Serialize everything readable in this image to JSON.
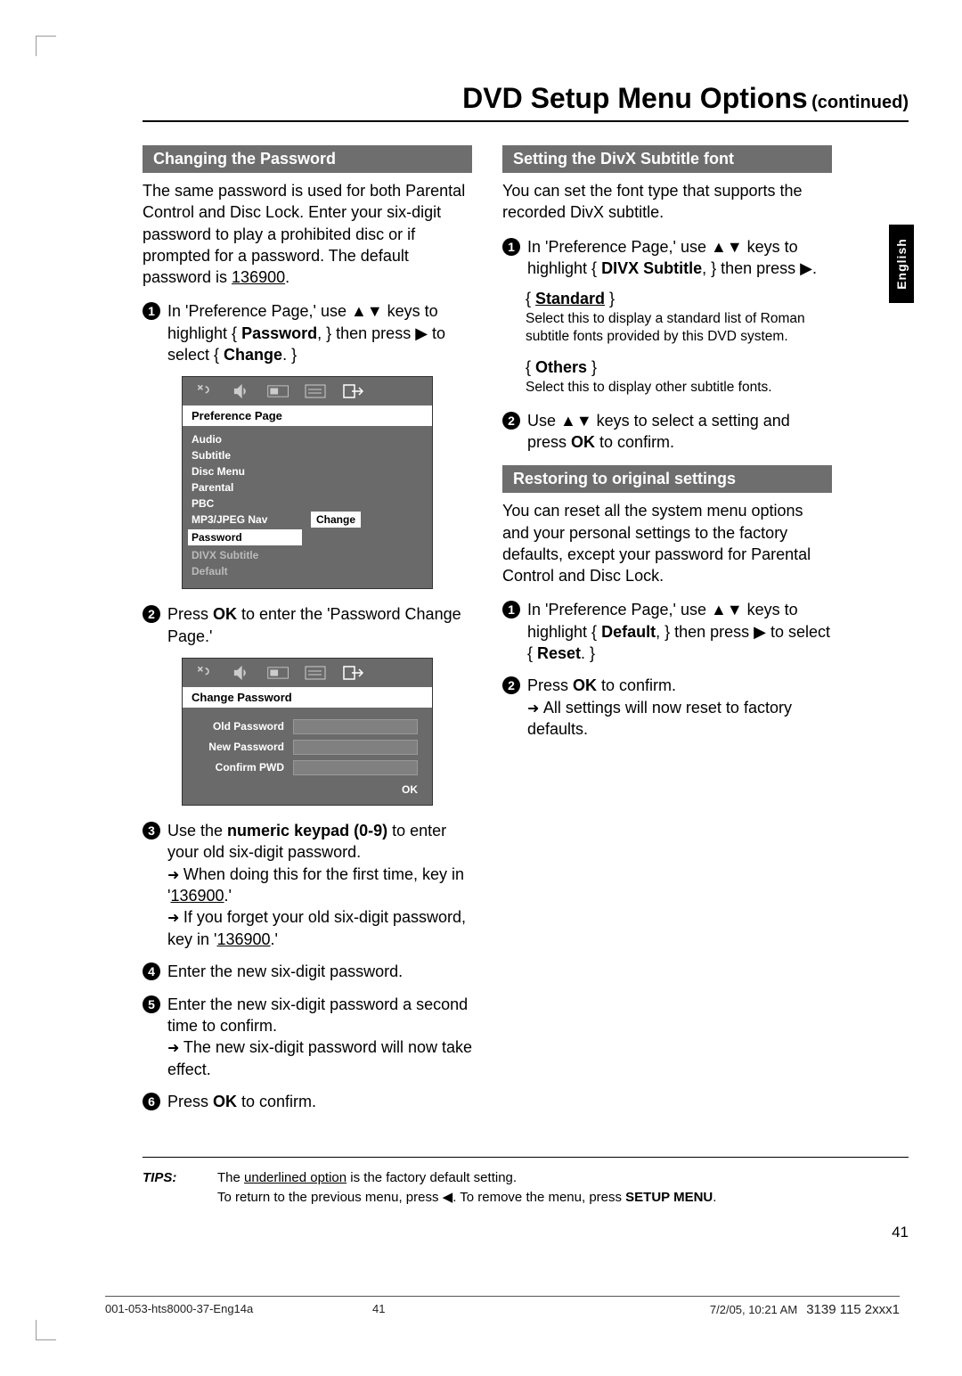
{
  "title": {
    "main": "DVD Setup Menu Options",
    "sub": "(continued)"
  },
  "lang_tab": "English",
  "left": {
    "header": "Changing the Password",
    "intro": "The same password is used for both Parental Control and Disc Lock.  Enter your six-digit password to play a prohibited disc or if prompted for a password.  The default password is ",
    "default_pwd": "136900",
    "step1_a": "In 'Preference Page,' use ",
    "step1_b": " keys to highlight { ",
    "step1_pwd": "Password",
    "step1_c": ", } then press ",
    "step1_d": " to select { ",
    "step1_change": "Change",
    "step1_e": ". }",
    "osd1": {
      "title": "Preference Page",
      "items": [
        "Audio",
        "Subtitle",
        "Disc Menu",
        "Parental",
        "PBC",
        "MP3/JPEG Nav",
        "Password",
        "DIVX Subtitle",
        "Default"
      ],
      "selected": "Password",
      "action": "Change"
    },
    "step2_a": "Press ",
    "step2_ok": "OK",
    "step2_b": " to enter the 'Password Change Page.'",
    "osd2": {
      "title": "Change Password",
      "rows": [
        "Old Password",
        "New Password",
        "Confirm PWD"
      ],
      "ok": "OK"
    },
    "step3_a": "Use the ",
    "step3_kbd": "numeric keypad (0-9)",
    "step3_b": " to enter your old six-digit password.",
    "step3_note1_a": "When doing this for the first time, key in '",
    "step3_note1_pwd": "136900",
    "step3_note1_b": ".'",
    "step3_note2_a": "If you forget your old six-digit password, key in '",
    "step3_note2_pwd": "136900",
    "step3_note2_b": ".'",
    "step4": "Enter the new six-digit password.",
    "step5_a": "Enter the new six-digit password a second time to confirm.",
    "step5_note": "The new six-digit password will now take effect.",
    "step6_a": "Press ",
    "step6_ok": "OK",
    "step6_b": " to confirm."
  },
  "right": {
    "header1": "Setting the DivX Subtitle font",
    "intro1": "You can set the font type that supports the recorded DivX subtitle.",
    "r1_a": "In 'Preference Page,' use ",
    "r1_b": " keys to highlight { ",
    "r1_divx": "DIVX Subtitle",
    "r1_c": ", } then press ",
    "r1_d": ".",
    "opt_standard": "Standard",
    "opt_standard_desc": "Select this to display a standard list of Roman subtitle fonts provided by this DVD system.",
    "opt_others": "Others",
    "opt_others_desc": "Select this to display other subtitle fonts.",
    "r2_a": "Use ",
    "r2_b": " keys to select a setting and press ",
    "r2_ok": "OK",
    "r2_c": " to confirm.",
    "header2": "Restoring to original settings",
    "intro2": "You can reset all the system menu options and your personal settings to the factory defaults, except your password for Parental Control and Disc Lock.",
    "s1_a": "In 'Preference Page,' use ",
    "s1_b": " keys to highlight { ",
    "s1_def": "Default",
    "s1_c": ", } then press ",
    "s1_d": " to select { ",
    "s1_reset": "Reset",
    "s1_e": ". }",
    "s2_a": "Press ",
    "s2_ok": "OK",
    "s2_b": " to confirm.",
    "s2_note": "All settings will now reset to factory defaults."
  },
  "tips": {
    "label": "TIPS:",
    "line1_a": "The ",
    "line1_u": "underlined option",
    "line1_b": " is the factory default setting.",
    "line2_a": "To return to the previous menu, press ",
    "line2_b": ".  To remove the menu, press ",
    "line2_btn": "SETUP MENU",
    "line2_c": "."
  },
  "page_num": "41",
  "footer": {
    "left": "001-053-hts8000-37-Eng14a",
    "mid": "41",
    "right_date": "7/2/05, 10:21 AM",
    "right_part": "3139 115 2xxx1"
  },
  "glyphs": {
    "updown": "▲▼",
    "right": "▶",
    "left": "◀"
  }
}
